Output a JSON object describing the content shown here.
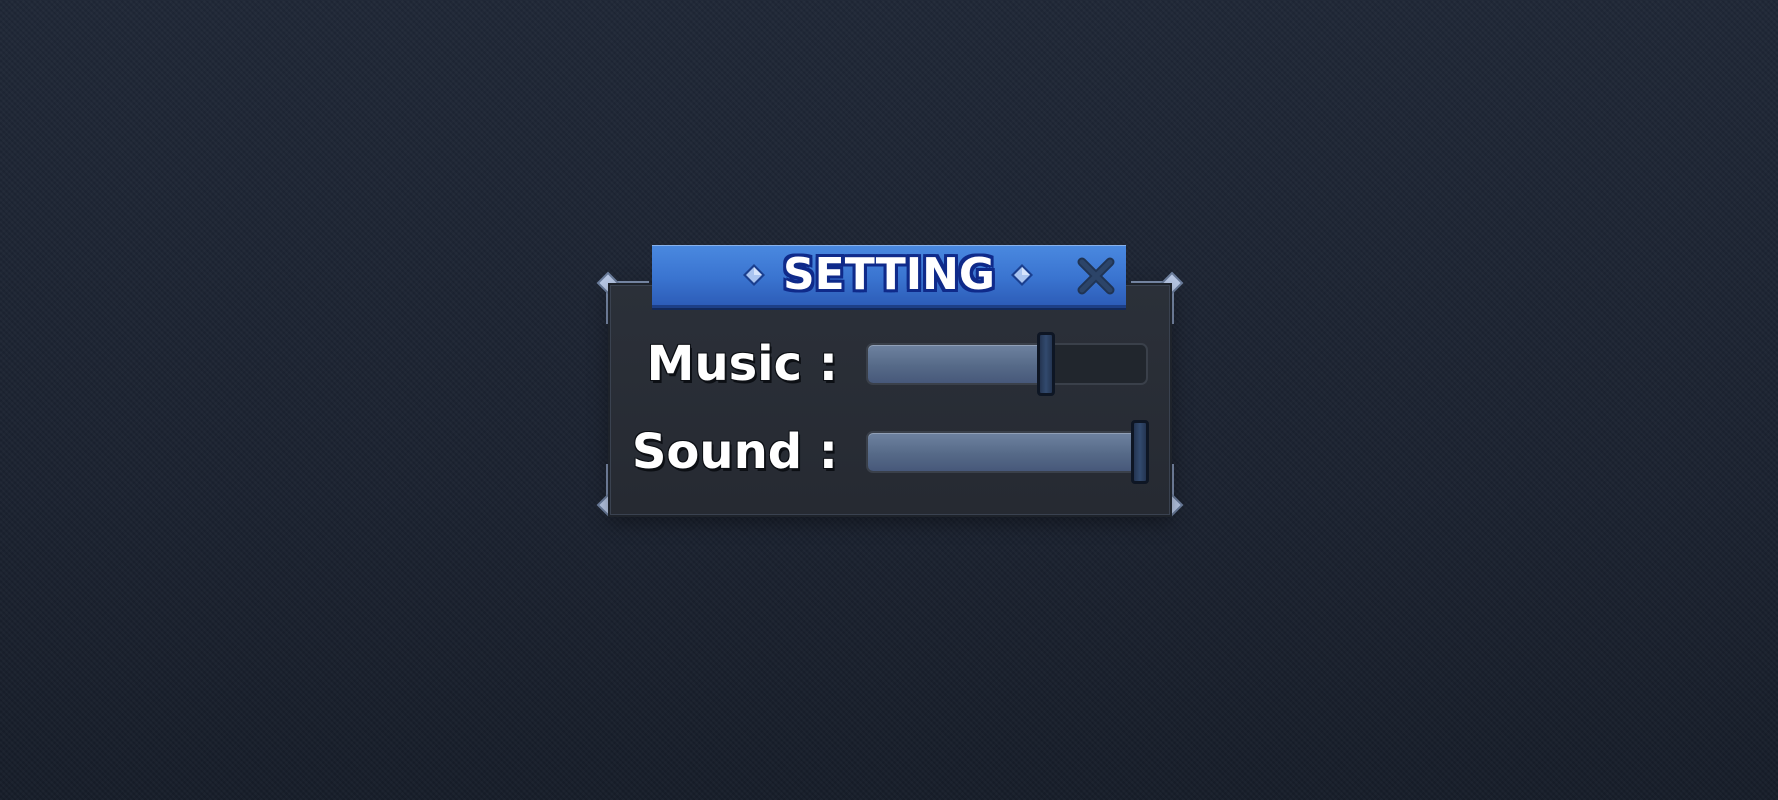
{
  "dialog": {
    "title": "SETTING",
    "close_icon": "close-icon"
  },
  "settings": [
    {
      "label": "Music :",
      "value_fraction": 0.64
    },
    {
      "label": "Sound :",
      "value_fraction": 0.98
    }
  ],
  "colors": {
    "title_bar": "#3a74d0",
    "title_outline": "#0f2a8a",
    "panel": "#282c34",
    "slider_fill": "#566a88",
    "slider_track": "#21262d",
    "handle": "#2a3d5c"
  }
}
